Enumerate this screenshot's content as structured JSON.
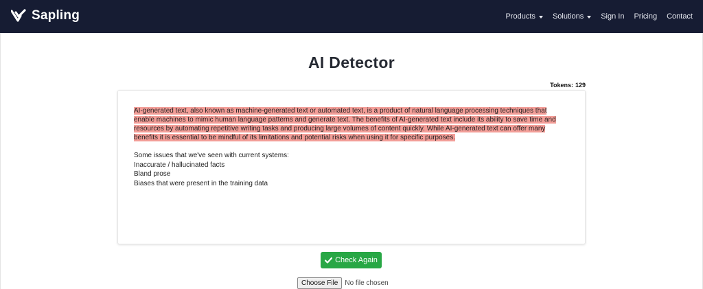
{
  "brand": {
    "name": "Sapling",
    "icon": "sapling-logo-icon"
  },
  "nav": {
    "items": [
      {
        "label": "Products",
        "has_caret": true
      },
      {
        "label": "Solutions",
        "has_caret": true
      },
      {
        "label": "Sign In",
        "has_caret": false
      },
      {
        "label": "Pricing",
        "has_caret": false
      },
      {
        "label": "Contact",
        "has_caret": false
      }
    ]
  },
  "page": {
    "title": "AI Detector"
  },
  "tokens": {
    "label": "Tokens:",
    "count": "129"
  },
  "editor": {
    "highlighted_text": "AI-generated text, also known as machine-generated text or automated text, is a product of natural language processing techniques that enable machines to mimic human language patterns and generate text. The benefits of AI-generated text include its ability to save time and resources by automating repetitive writing tasks and producing large volumes of content quickly. While AI-generated text can offer many benefits it is essential to be mindful of its limitations and potential risks when using it for specific purposes.",
    "highlight_color": "#f39e98",
    "lines": [
      "Some issues that we've seen with current systems:",
      "Inaccurate / hallucinated facts",
      "Bland prose",
      "Biases that were present in the training data"
    ]
  },
  "check_button": {
    "label": "Check Again",
    "icon": "check-icon",
    "color": "#28a745"
  },
  "file_input": {
    "button_label": "Choose File",
    "status": "No file chosen"
  },
  "colors": {
    "navbar": "#161c33"
  }
}
